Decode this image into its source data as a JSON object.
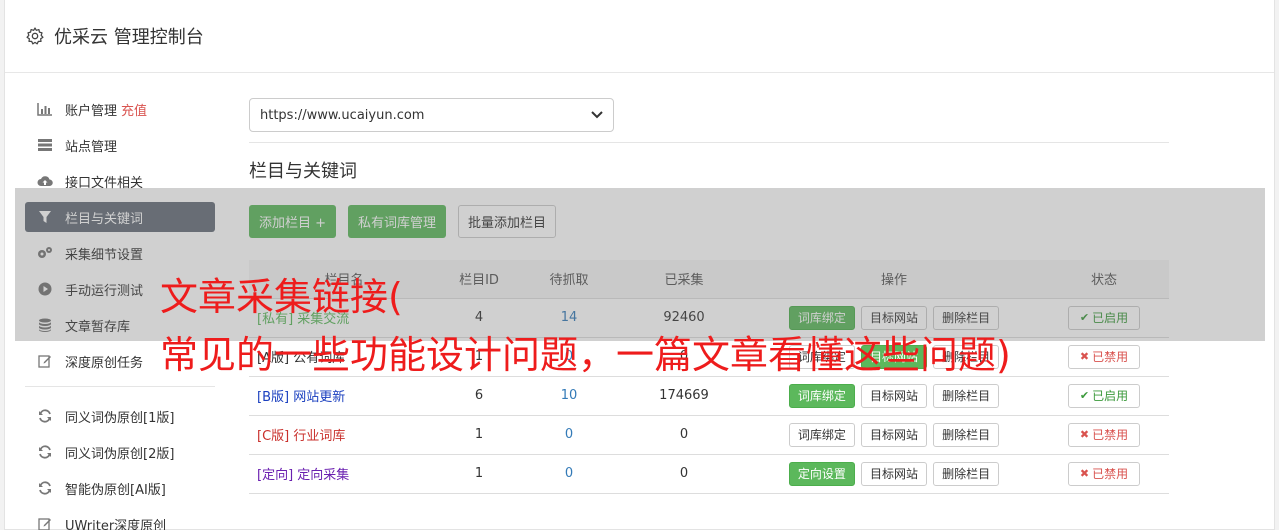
{
  "header": {
    "title": "优采云 管理控制台",
    "icon": "gear-icon"
  },
  "sidebar": {
    "items": [
      {
        "label": "账户管理",
        "highlight": "充值",
        "icon": "bar-chart-icon",
        "active": false
      },
      {
        "label": "站点管理",
        "icon": "server-icon",
        "active": false
      },
      {
        "label": "接口文件相关",
        "icon": "cloud-upload-icon",
        "active": false
      },
      {
        "label": "栏目与关键词",
        "icon": "filter-icon",
        "active": true
      },
      {
        "label": "采集细节设置",
        "icon": "cogs-icon",
        "active": false
      },
      {
        "label": "手动运行测试",
        "icon": "play-icon",
        "active": false
      },
      {
        "label": "文章暂存库",
        "icon": "database-icon",
        "active": false
      },
      {
        "label": "深度原创任务",
        "icon": "edit-icon",
        "active": false
      }
    ],
    "items2": [
      {
        "label": "同义词伪原创[1版]",
        "icon": "refresh-icon"
      },
      {
        "label": "同义词伪原创[2版]",
        "icon": "refresh-icon"
      },
      {
        "label": "智能伪原创[AI版]",
        "icon": "refresh-icon"
      },
      {
        "label": "UWriter深度原创",
        "icon": "edit-icon"
      }
    ]
  },
  "main": {
    "site_select": "https://www.ucaiyun.com",
    "section_title": "栏目与关键词",
    "buttons": {
      "add": "添加栏目 +",
      "private": "私有词库管理",
      "batch": "批量添加栏目"
    },
    "table": {
      "headers": [
        "栏目名",
        "栏目ID",
        "待抓取",
        "已采集",
        "操作",
        "状态"
      ],
      "rows": [
        {
          "tag": "[私有]",
          "name": "采集交流",
          "id": "4",
          "pending": "14",
          "collected": "92460",
          "op1": "词库绑定",
          "op2": "目标网站",
          "op3": "删除栏目",
          "status": "已启用",
          "enabled": true
        },
        {
          "tag": "[A版]",
          "name": "公有词库",
          "id": "1",
          "pending": "0",
          "collected": "0",
          "op1": "词库绑定",
          "op2": "目标网站",
          "op3": "删除栏目",
          "status": "已禁用",
          "enabled": false
        },
        {
          "tag": "[B版]",
          "name": "网站更新",
          "id": "6",
          "pending": "10",
          "collected": "174669",
          "op1": "词库绑定",
          "op2": "目标网站",
          "op3": "删除栏目",
          "status": "已启用",
          "enabled": true
        },
        {
          "tag": "[C版]",
          "name": "行业词库",
          "id": "1",
          "pending": "0",
          "collected": "0",
          "op1": "词库绑定",
          "op2": "目标网站",
          "op3": "删除栏目",
          "status": "已禁用",
          "enabled": false
        },
        {
          "tag": "[定向]",
          "name": "定向采集",
          "id": "1",
          "pending": "0",
          "collected": "0",
          "op1": "定向设置",
          "op2": "目标网站",
          "op3": "删除栏目",
          "status": "已禁用",
          "enabled": false
        }
      ]
    }
  },
  "overlay": {
    "line1": "文章采集链接(",
    "line2": "常见的一些功能设计问题，一篇文章看懂这些问题)"
  },
  "colors": {
    "accent_green": "#5cb85c",
    "active_sidebar": "#666e7a",
    "overlay_text": "#ee1c1c"
  }
}
